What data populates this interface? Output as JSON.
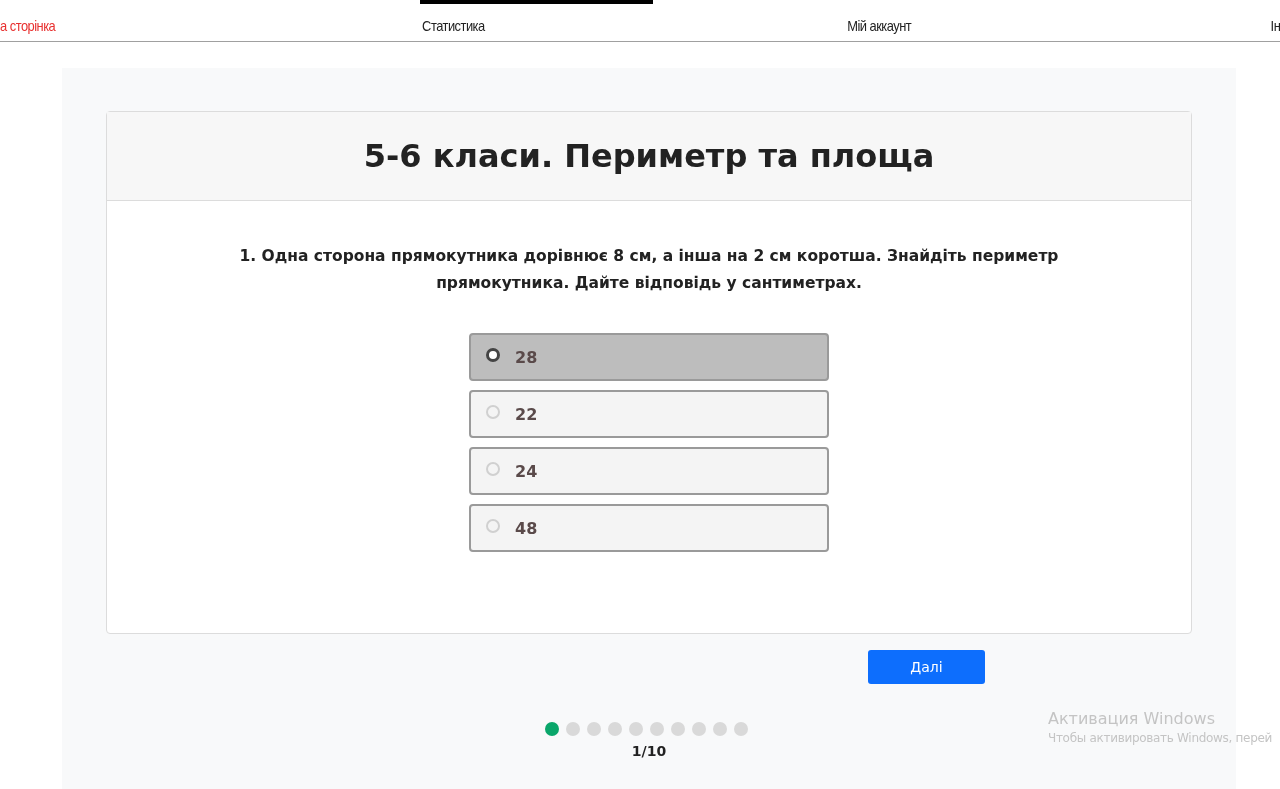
{
  "nav": [
    {
      "label": "а сторінка",
      "selected": true
    },
    {
      "label": "Статистика",
      "selected": false
    },
    {
      "label": "Мій аккаунт",
      "selected": false
    },
    {
      "label": "Ін",
      "selected": false
    }
  ],
  "quiz": {
    "title": "5-6 класи. Периметр та площа",
    "question": "1. Одна сторона прямокутника дорівнює 8 см, а інша на 2 см коротша. Знайдіть периметр прямокутника. Дайте відповідь у сантиметрах.",
    "options": [
      {
        "label": "28",
        "selected": true
      },
      {
        "label": "22",
        "selected": false
      },
      {
        "label": "24",
        "selected": false
      },
      {
        "label": "48",
        "selected": false
      }
    ],
    "next_button": "Далі",
    "progress": [
      {
        "selected": true
      },
      {
        "selected": false
      },
      {
        "selected": false
      },
      {
        "selected": false
      },
      {
        "selected": false
      },
      {
        "selected": false
      },
      {
        "selected": false
      },
      {
        "selected": false
      },
      {
        "selected": false
      },
      {
        "selected": false
      }
    ],
    "counter": "1/10"
  },
  "os_notice": {
    "title": "Активация Windows",
    "text": "Чтобы активировать Windows, перей"
  }
}
